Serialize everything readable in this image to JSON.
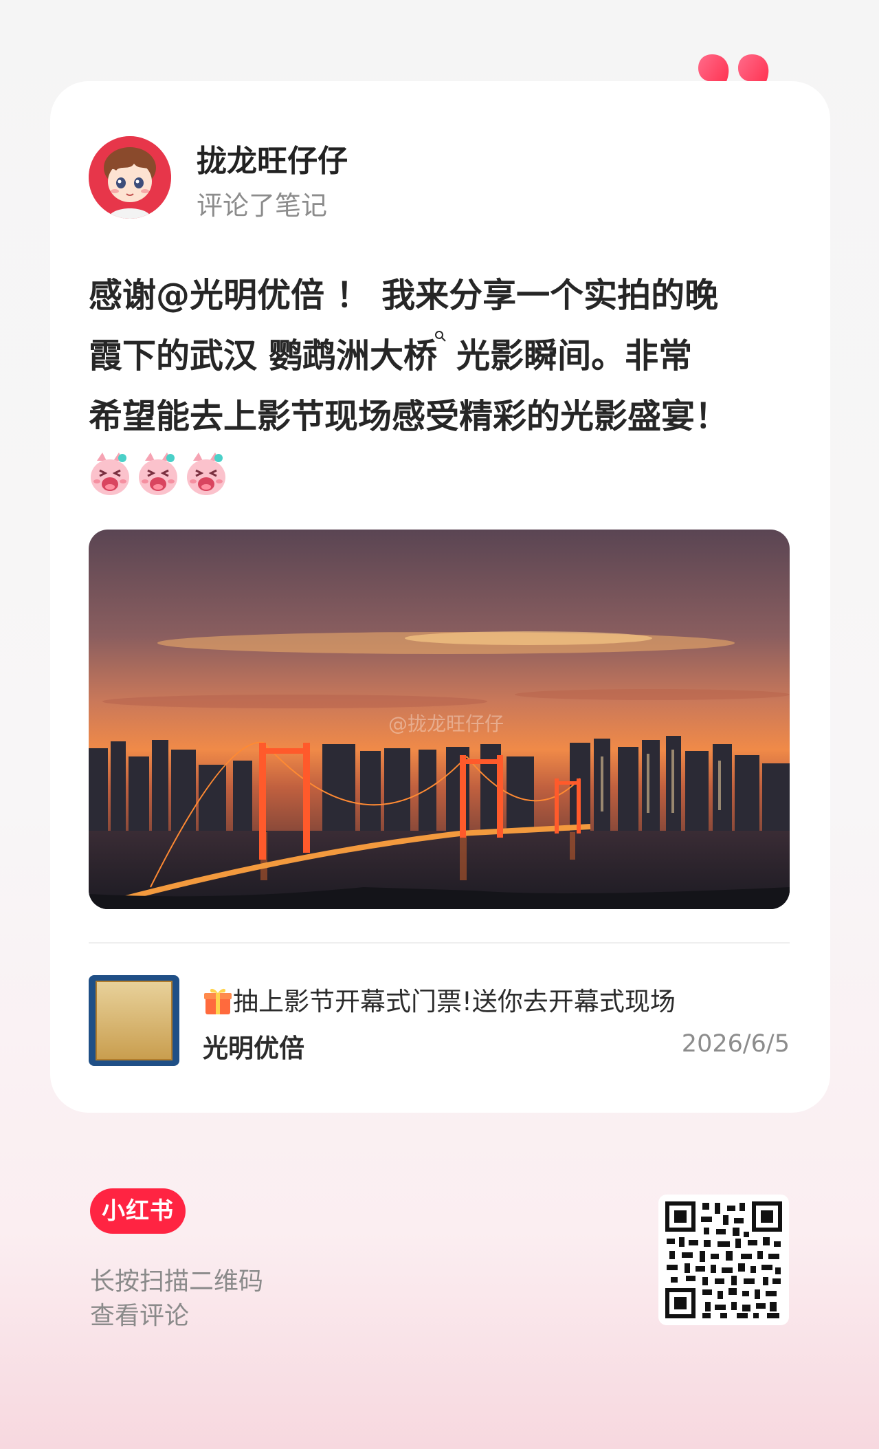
{
  "header": {
    "username": "拢龙旺仔仔",
    "action_text": "评论了笔记"
  },
  "post": {
    "lines": [
      "感谢@光明优倍 ！ 我来分享一个实拍的晚",
      "霞下的武汉 鹦鹉洲大桥",
      "光影瞬间。非常",
      "希望能去上影节现场感受精彩的光影盛宴！"
    ],
    "emoji_count": 3,
    "emoji_icon": "laughing-pig-emoji-icon",
    "photo_watermark": "@拢龙旺仔仔"
  },
  "linked_note": {
    "title": "抽上影节开幕式门票!送你去开幕式现场",
    "author": "光明优倍",
    "date": "2026/6/5",
    "title_icon": "gift-icon"
  },
  "footer": {
    "brand": "小红书",
    "scan_line1": "长按扫描二维码",
    "scan_line2": "查看评论"
  },
  "colors": {
    "brand_red": "#ff2442",
    "quote_red": "#ff2d55",
    "muted_text": "#8c8c8c"
  }
}
